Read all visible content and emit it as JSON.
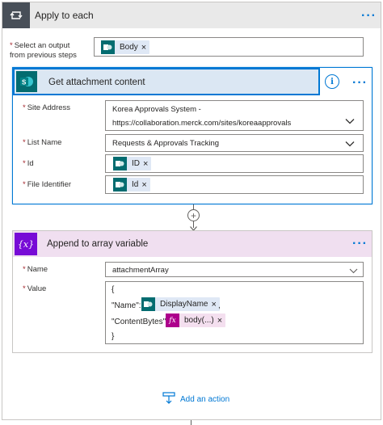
{
  "apply_each": {
    "title": "Apply to each",
    "select_label_line1": "Select an output",
    "select_label_line2": "from previous steps",
    "select_token": "Body"
  },
  "get_attachment": {
    "title": "Get attachment content",
    "site_address_label": "Site Address",
    "site_address_line1": "Korea Approvals System -",
    "site_address_line2": "https://collaboration.merck.com/sites/koreaapprovals",
    "list_name_label": "List Name",
    "list_name_value": "Requests & Approvals Tracking",
    "id_label": "Id",
    "id_token": "ID",
    "file_identifier_label": "File Identifier",
    "file_identifier_token": "Id"
  },
  "append_variable": {
    "title": "Append to array variable",
    "name_label": "Name",
    "name_value": "attachmentArray",
    "value_label": "Value",
    "line_open": "{",
    "name_key": "\"Name\":",
    "name_token": "DisplayName",
    "name_comma": ",",
    "content_key": "\"ContentBytes\":",
    "content_token": "body(...)",
    "line_close": "}"
  },
  "add_action": {
    "label": "Add an action"
  },
  "symbols": {
    "required": "*",
    "remove": "×",
    "more": "···",
    "info": "i",
    "plus": "+",
    "chevron": "⌄",
    "fx": "fx",
    "var": "{x}"
  },
  "colors": {
    "accent": "#0078d4",
    "sharepoint": "#036c70",
    "variable": "#770bd6",
    "expression": "#ad008c"
  },
  "icons": [
    "loop-icon",
    "sharepoint-icon",
    "variable-icon",
    "info-icon",
    "expression-icon",
    "add-action-icon"
  ]
}
